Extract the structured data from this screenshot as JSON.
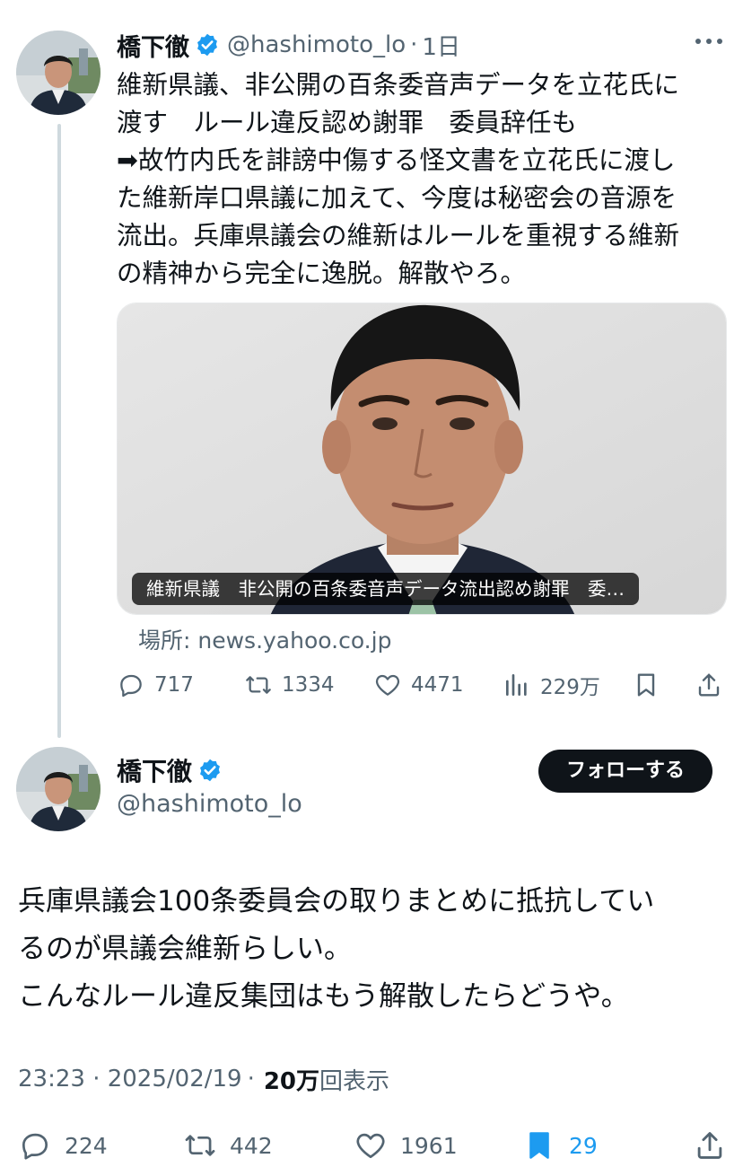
{
  "parent_tweet": {
    "author_name": "橋下徹",
    "handle": "@hashimoto_lo",
    "separator": "·",
    "time": "1日",
    "text": "維新県議、非公開の百条委音声データを立花氏に\n渡す　ルール違反認め謝罪　委員辞任も\n➡故竹内氏を誹謗中傷する怪文書を立花氏に渡し\nた維新岸口県議に加えて、今度は秘密会の音源を\n流出。兵庫県議会の維新はルールを重視する維新\nの精神から完全に逸脱。解散やろ。",
    "media_caption": "維新県議　非公開の百条委音声データ流出認め謝罪　委…",
    "source": "場所: news.yahoo.co.jp",
    "stats": {
      "replies": "717",
      "reposts": "1334",
      "likes": "4471",
      "views": "229万"
    }
  },
  "main_tweet": {
    "author_name": "橋下徹",
    "handle": "@hashimoto_lo",
    "follow_label": "フォローする",
    "text": "兵庫県議会100条委員会の取りまとめに抵抗してい\nるのが県議会維新らしい。\nこんなルール違反集団はもう解散したらどうや。",
    "timestamp": "23:23 · 2025/02/19",
    "separator": "·",
    "views_count": "20万",
    "views_label": "回表示",
    "stats": {
      "replies": "224",
      "reposts": "442",
      "likes": "1961",
      "bookmarks": "29"
    }
  },
  "colors": {
    "text": "#0f1419",
    "secondary": "#536471",
    "verified_blue": "#1d9bf0",
    "follow_button": "#0f1419",
    "thread_line": "#cfd9de"
  },
  "icons": [
    "verified-badge-icon",
    "more-icon",
    "reply-icon",
    "repost-icon",
    "like-icon",
    "views-icon",
    "bookmark-icon",
    "share-icon"
  ]
}
